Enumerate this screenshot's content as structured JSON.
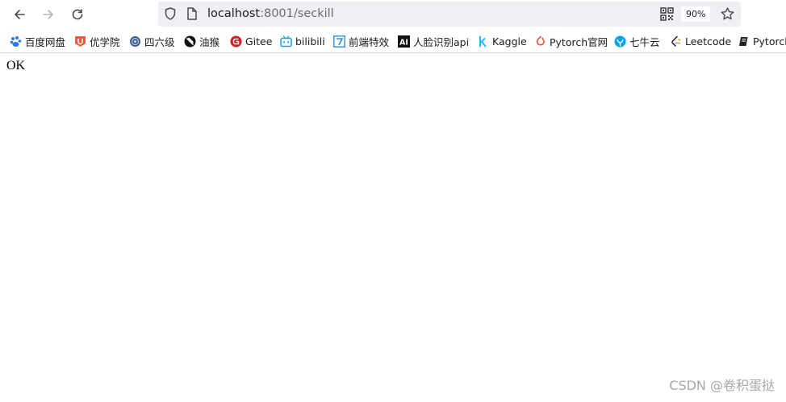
{
  "toolbar": {
    "url_host": "localhost",
    "url_path": ":8001/seckill",
    "zoom": "90%"
  },
  "icons": {
    "back": "back-arrow-icon",
    "forward": "forward-arrow-icon",
    "reload": "reload-icon",
    "shield": "shield-icon",
    "page": "page-icon",
    "qr": "qr-code-icon",
    "bookmark_star": "star-icon"
  },
  "bookmarks": [
    {
      "label": "百度网盘",
      "icon": "baidu-pan-icon",
      "color": "#2b7bef"
    },
    {
      "label": "优学院",
      "icon": "youxueyuan-icon",
      "color": "#f05a3c"
    },
    {
      "label": "四六级",
      "icon": "cet-icon",
      "color": "#3c5a8c"
    },
    {
      "label": "油猴",
      "icon": "tampermonkey-icon",
      "color": "#111111"
    },
    {
      "label": "Gitee",
      "icon": "gitee-icon",
      "color": "#c71d23"
    },
    {
      "label": "bilibili",
      "icon": "bilibili-icon",
      "color": "#1aa3e0"
    },
    {
      "label": "前端特效",
      "icon": "frontend-effects-icon",
      "color": "#2b8fd6"
    },
    {
      "label": "人脸识别api",
      "icon": "ai-icon",
      "color": "#111111"
    },
    {
      "label": "Kaggle",
      "icon": "kaggle-icon",
      "color": "#20beff"
    },
    {
      "label": "Pytorch官网",
      "icon": "pytorch-icon",
      "color": "#ee4c2c"
    },
    {
      "label": "七牛云",
      "icon": "qiniu-icon",
      "color": "#07a3e6"
    },
    {
      "label": "Leetcode",
      "icon": "leetcode-icon",
      "color": "#f0a01c"
    },
    {
      "label": "Pytorch",
      "icon": "book-icon",
      "color": "#222222"
    }
  ],
  "content": {
    "body_text": "OK"
  },
  "watermark": "CSDN @卷积蛋挞"
}
